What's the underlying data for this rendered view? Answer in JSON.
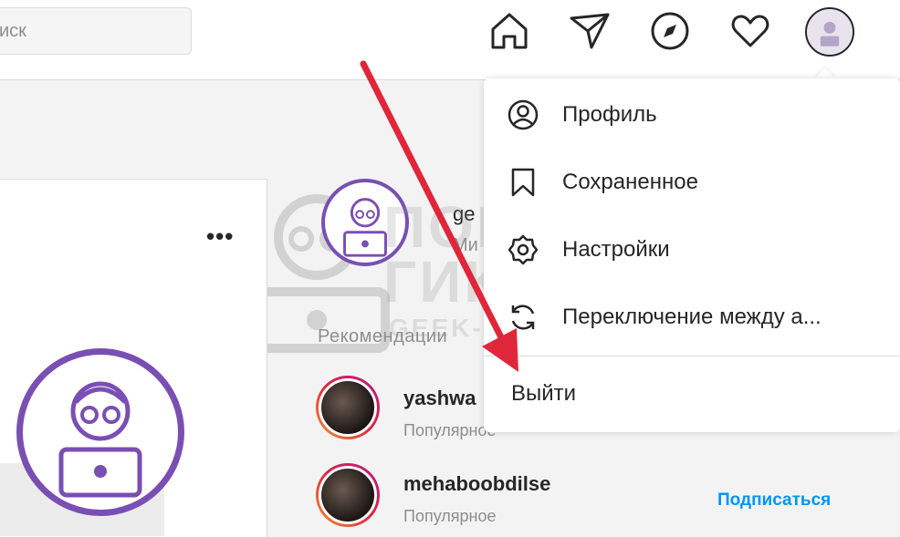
{
  "search": {
    "placeholder": "иск"
  },
  "nav": {
    "icons": [
      "home-icon",
      "direct-icon",
      "explore-icon",
      "activity-icon",
      "profile-avatar"
    ]
  },
  "profile_menu": {
    "items": [
      {
        "label": "Профиль",
        "icon": "profile-icon"
      },
      {
        "label": "Сохраненное",
        "icon": "bookmark-icon"
      },
      {
        "label": "Настройки",
        "icon": "gear-icon"
      },
      {
        "label": "Переключение между а...",
        "icon": "switch-icon"
      }
    ],
    "logout_label": "Выйти"
  },
  "sidebar": {
    "username": "ge",
    "name": "Ми",
    "suggestions_title": "Рекомендации",
    "suggestions": [
      {
        "username": "yashwa",
        "subtitle": "Популярное"
      },
      {
        "username": "mehaboobdilse",
        "subtitle": "Популярное",
        "action": "Подписаться"
      }
    ]
  },
  "feed": {
    "more_label": "•••"
  },
  "watermark": {
    "line1": "ПОМОЩЬ",
    "line2": "ГИКА",
    "url": "GEEK-HELP.RU"
  },
  "colors": {
    "accent_link": "#0095f6",
    "avatar_ring": "#7a4fb3",
    "arrow": "#e0263a"
  }
}
